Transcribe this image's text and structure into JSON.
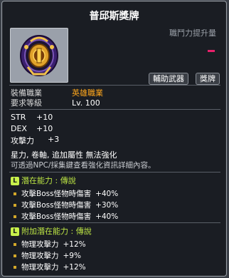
{
  "item": {
    "name": "普邱斯獎牌",
    "power_label": "職鬥力提升量",
    "tags": [
      "輔助武器",
      "獎牌"
    ],
    "job_label": "裝備職業",
    "job_value": "英雄職業",
    "level_label": "要求等級",
    "level_value": "Lv. 100"
  },
  "stats": [
    {
      "name": "STR",
      "value": "+10"
    },
    {
      "name": "DEX",
      "value": "+10"
    },
    {
      "name": "攻擊力",
      "value": "+3"
    }
  ],
  "notes": {
    "enhance": "星力, 卷軸, 追加屬性 無法強化",
    "npc": "可透過NPC/採集鍵查看強化資訊詳細內容。"
  },
  "potential": {
    "badge": "L",
    "header": "潛在能力 : 傳說",
    "lines": [
      {
        "text": "攻擊Boss怪物時傷害",
        "value": "+40%"
      },
      {
        "text": "攻擊Boss怪物時傷害",
        "value": "+30%"
      },
      {
        "text": "攻擊Boss怪物時傷害",
        "value": "+40%"
      }
    ]
  },
  "additional": {
    "badge": "L",
    "header": "附加潛在能力 : 傳說",
    "lines": [
      {
        "text": "物理攻擊力",
        "value": "+12%"
      },
      {
        "text": "物理攻擊力",
        "value": "+9%"
      },
      {
        "text": "物理攻擊力",
        "value": "+12%"
      }
    ]
  },
  "colors": {
    "job_highlight": "#ffa71c",
    "potential_legend": "#bde644",
    "power_marker": "#e8206a"
  },
  "icons": {
    "item_icon": "golden-medal-icon",
    "bullet": "square-bullet-icon"
  }
}
